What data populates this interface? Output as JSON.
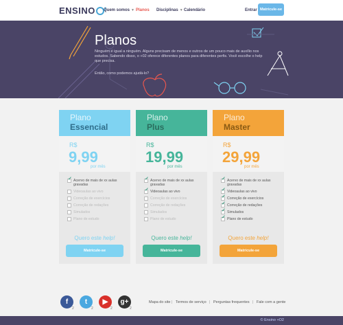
{
  "header": {
    "logo_text": "ENSINO",
    "logo_sub": "2",
    "nav": [
      "Quem somos",
      "Planos",
      "Disciplinas",
      "Calendário"
    ],
    "enter_label": "Entrar",
    "cta_label": "Matricule-se"
  },
  "hero": {
    "title": "Planos",
    "text": "Ninguém é igual a ninguém. Alguns precisam de menos e outros de um pouco mais de auxílio nos estudos. Sabendo disso, o +02 oferece diferentes planos para diferentes perfis. Você escolhe o help que precisa.",
    "question": "Então, como podemos ajudá-lo?"
  },
  "plans": [
    {
      "label": "Plano",
      "name": "Essencial",
      "currency": "R$",
      "price": "9,99",
      "period": "por mês",
      "features": [
        {
          "text": "Acervo de mais de xx aulas gravadas",
          "on": true
        },
        {
          "text": "Videoaulas ao vivo",
          "on": false
        },
        {
          "text": "Correção de exercícios",
          "on": false
        },
        {
          "text": "Correção de redações",
          "on": false
        },
        {
          "text": "Simulados",
          "on": false
        },
        {
          "text": "Plano de estudo",
          "on": false
        }
      ],
      "want_prefix": "Quero este",
      "want_suffix": "help!",
      "button": "Matricule-se",
      "color": "#7fd3f2",
      "dark": "#2f6d8a"
    },
    {
      "label": "Plano",
      "name": "Plus",
      "currency": "R$",
      "price": "19,99",
      "period": "por mês",
      "features": [
        {
          "text": "Acervo de mais de xx aulas gravadas",
          "on": true
        },
        {
          "text": "Videoaulas ao vivo",
          "on": true
        },
        {
          "text": "Correção de exercícios",
          "on": false
        },
        {
          "text": "Correção de redações",
          "on": false
        },
        {
          "text": "Simulados",
          "on": false
        },
        {
          "text": "Plano de estudo",
          "on": false
        }
      ],
      "want_prefix": "Quero este",
      "want_suffix": "help!",
      "button": "Matricule-se",
      "color": "#46b59a",
      "dark": "#2b6d5e"
    },
    {
      "label": "Plano",
      "name": "Master",
      "currency": "R$",
      "price": "29,99",
      "period": "por mês",
      "features": [
        {
          "text": "Acervo de mais de xx aulas gravadas",
          "on": true
        },
        {
          "text": "Videoaulas ao vivo",
          "on": true
        },
        {
          "text": "Correção de exercícios",
          "on": true
        },
        {
          "text": "Correção de redações",
          "on": true
        },
        {
          "text": "Simulados",
          "on": true
        },
        {
          "text": "Plano de estudo",
          "on": true
        }
      ],
      "want_prefix": "Quero este",
      "want_suffix": "help!",
      "button": "Matricule-se",
      "color": "#f3a43a",
      "dark": "#8a5a13"
    }
  ],
  "footer": {
    "social": [
      {
        "icon": "facebook-icon",
        "glyph": "f",
        "count": "2",
        "color": "#3b5998"
      },
      {
        "icon": "twitter-icon",
        "glyph": "t",
        "count": "2",
        "color": "#4aa8e0"
      },
      {
        "icon": "youtube-icon",
        "glyph": "▶",
        "count": "2",
        "color": "#d9302a"
      },
      {
        "icon": "googleplus-icon",
        "glyph": "g+",
        "count": "2",
        "color": "#333333"
      }
    ],
    "links": [
      "Mapa do site",
      "Termos de serviço",
      "Perguntas frequentes",
      "Fale com a gente"
    ],
    "copyright": "© Ensino +O2"
  }
}
